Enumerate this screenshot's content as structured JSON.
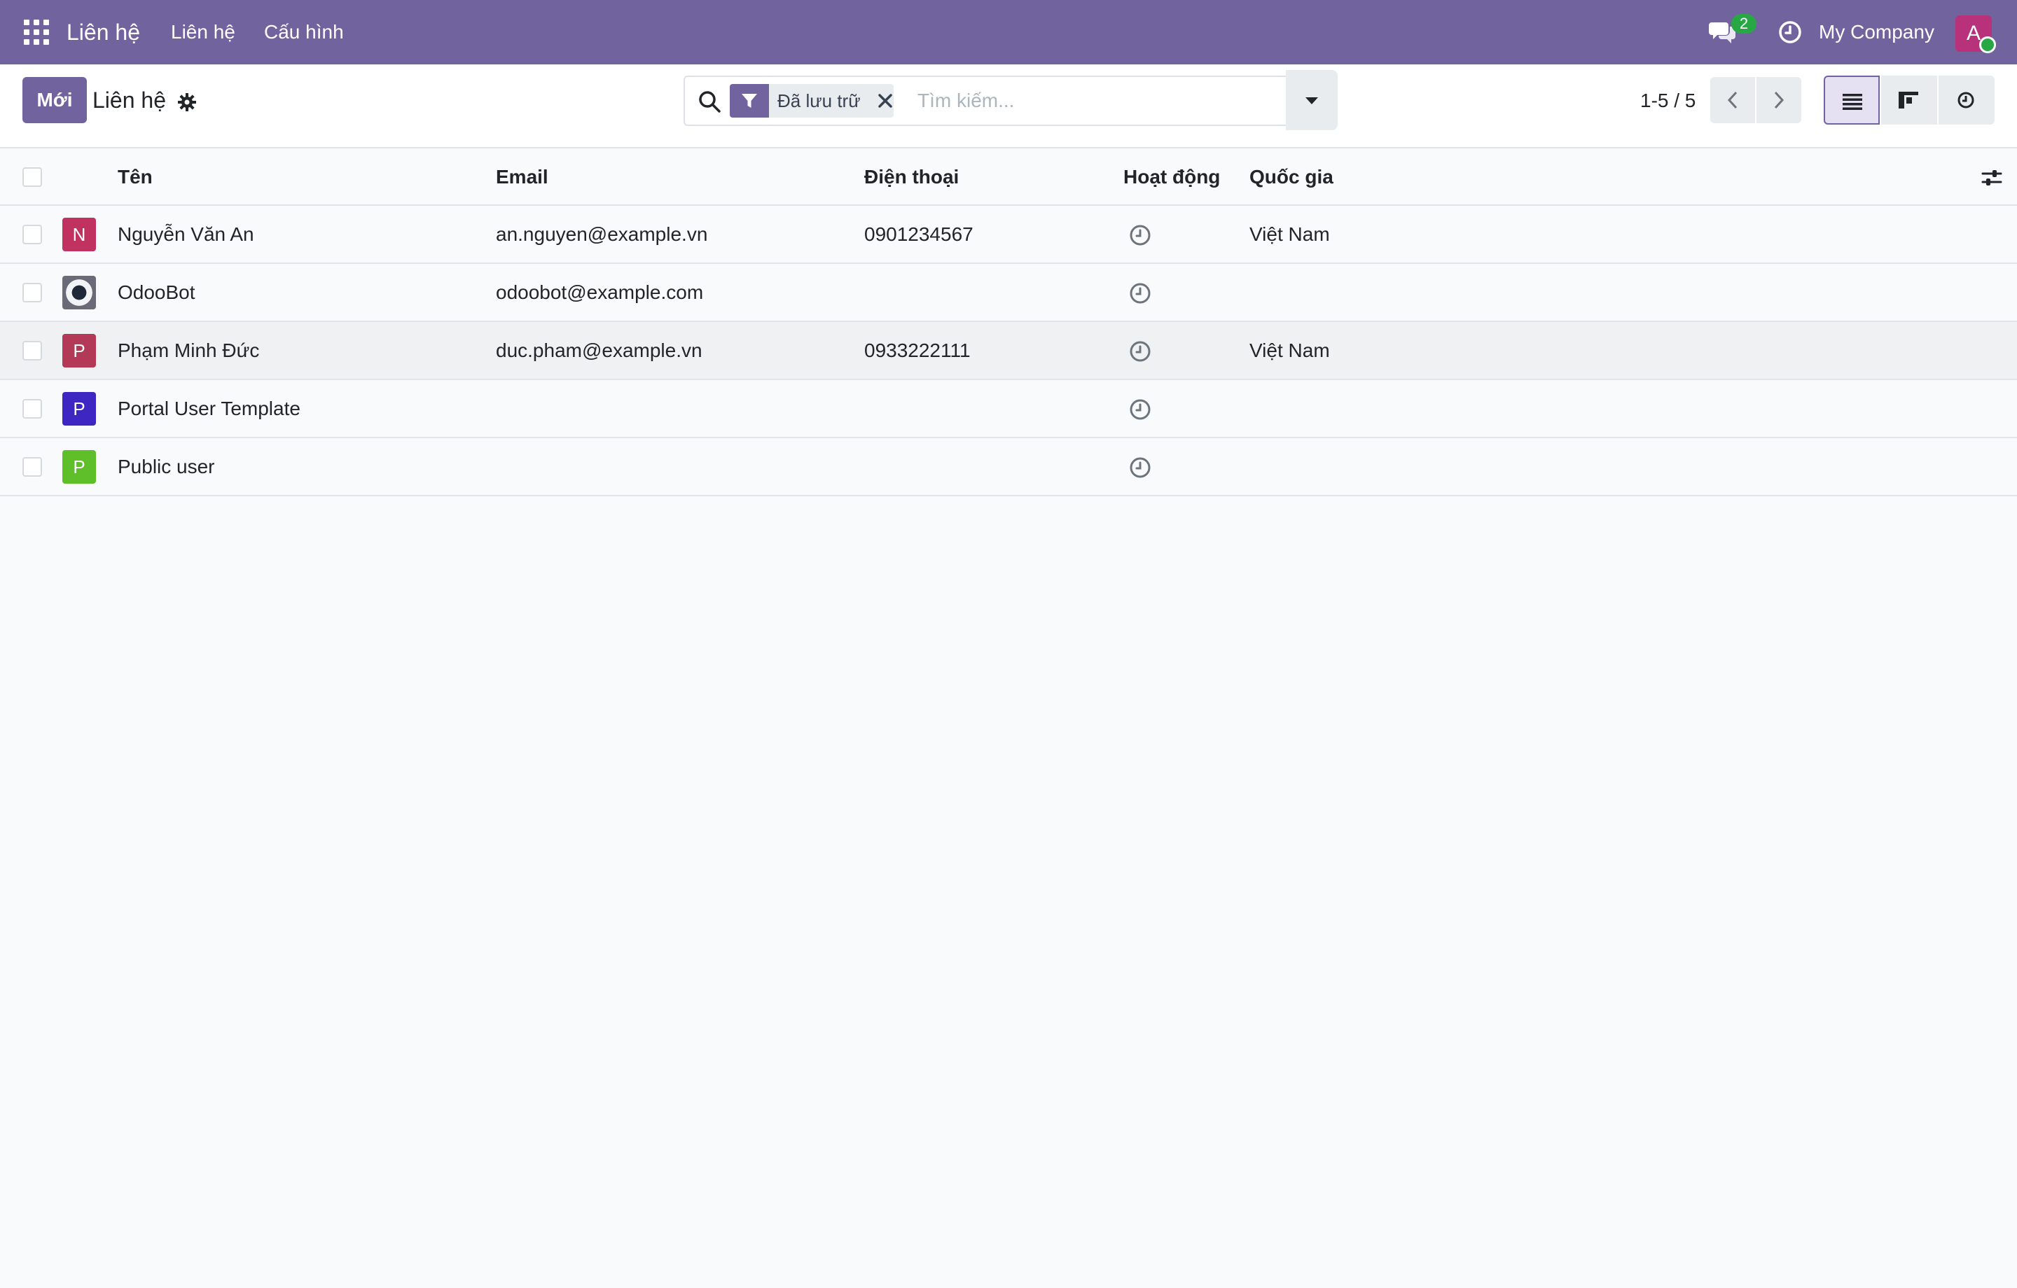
{
  "nav": {
    "brand": "Liên hệ",
    "menu": [
      "Liên hệ",
      "Cấu hình"
    ],
    "chat_badge": "2",
    "company": "My Company",
    "avatar_letter": "A"
  },
  "control": {
    "new_label": "Mới",
    "breadcrumb": "Liên hệ",
    "facet_value": "Đã lưu trữ",
    "search_placeholder": "Tìm kiếm...",
    "pager": "1-5 / 5"
  },
  "table": {
    "columns": [
      "Tên",
      "Email",
      "Điện thoại",
      "Hoạt động",
      "Quốc gia"
    ],
    "rows": [
      {
        "avatar": "N",
        "avatar_color": "#c0325f",
        "name": "Nguyễn Văn An",
        "email": "an.nguyen@example.vn",
        "phone": "0901234567",
        "country": "Việt Nam"
      },
      {
        "avatar": "",
        "avatar_color": "#6b6b78",
        "name": "OdooBot",
        "email": "odoobot@example.com",
        "phone": "",
        "country": ""
      },
      {
        "avatar": "P",
        "avatar_color": "#b23a56",
        "name": "Phạm Minh Đức",
        "email": "duc.pham@example.vn",
        "phone": "0933222111",
        "country": "Việt Nam"
      },
      {
        "avatar": "P",
        "avatar_color": "#3d26c1",
        "name": "Portal User Template",
        "email": "",
        "phone": "",
        "country": ""
      },
      {
        "avatar": "P",
        "avatar_color": "#5fbf2a",
        "name": "Public user",
        "email": "",
        "phone": "",
        "country": ""
      }
    ]
  },
  "colors": {
    "brand": "#71639e",
    "badge": "#28a745"
  },
  "icons": [
    "apps-grid-icon",
    "chat-icon",
    "clock-icon",
    "gear-icon",
    "search-icon",
    "filter-icon",
    "close-icon",
    "caret-down-icon",
    "chevron-left-icon",
    "chevron-right-icon",
    "list-view-icon",
    "kanban-view-icon",
    "activity-view-icon",
    "optional-columns-icon",
    "activity-clock-icon"
  ]
}
